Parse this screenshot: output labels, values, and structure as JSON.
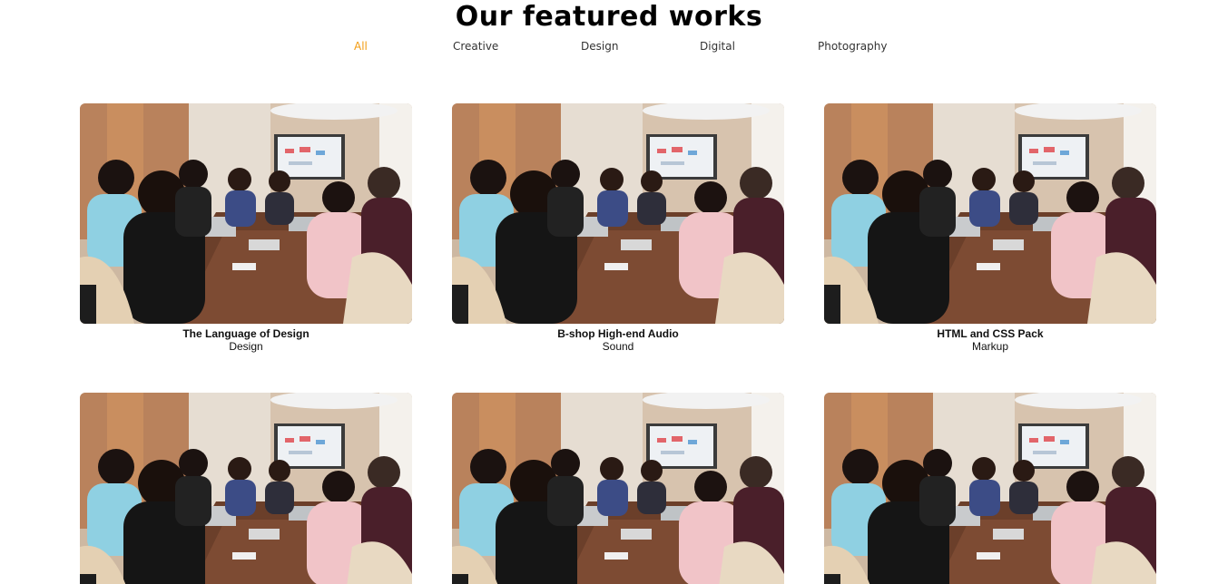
{
  "header": {
    "title": "Our featured works"
  },
  "filters": [
    {
      "label": "All",
      "active": true
    },
    {
      "label": "Creative",
      "active": false
    },
    {
      "label": "Design",
      "active": false
    },
    {
      "label": "Digital",
      "active": false
    },
    {
      "label": "Photography",
      "active": false
    }
  ],
  "accent_color": "#f39c12",
  "works": [
    {
      "title": "The Language of Design",
      "category": "Design",
      "image": "office-meeting-photo"
    },
    {
      "title": "B-shop High-end Audio",
      "category": "Sound",
      "image": "office-meeting-photo"
    },
    {
      "title": "HTML and CSS Pack",
      "category": "Markup",
      "image": "office-meeting-photo"
    },
    {
      "title": "",
      "category": "",
      "image": "office-meeting-photo"
    },
    {
      "title": "",
      "category": "",
      "image": "office-meeting-photo"
    },
    {
      "title": "",
      "category": "",
      "image": "office-meeting-photo"
    }
  ]
}
